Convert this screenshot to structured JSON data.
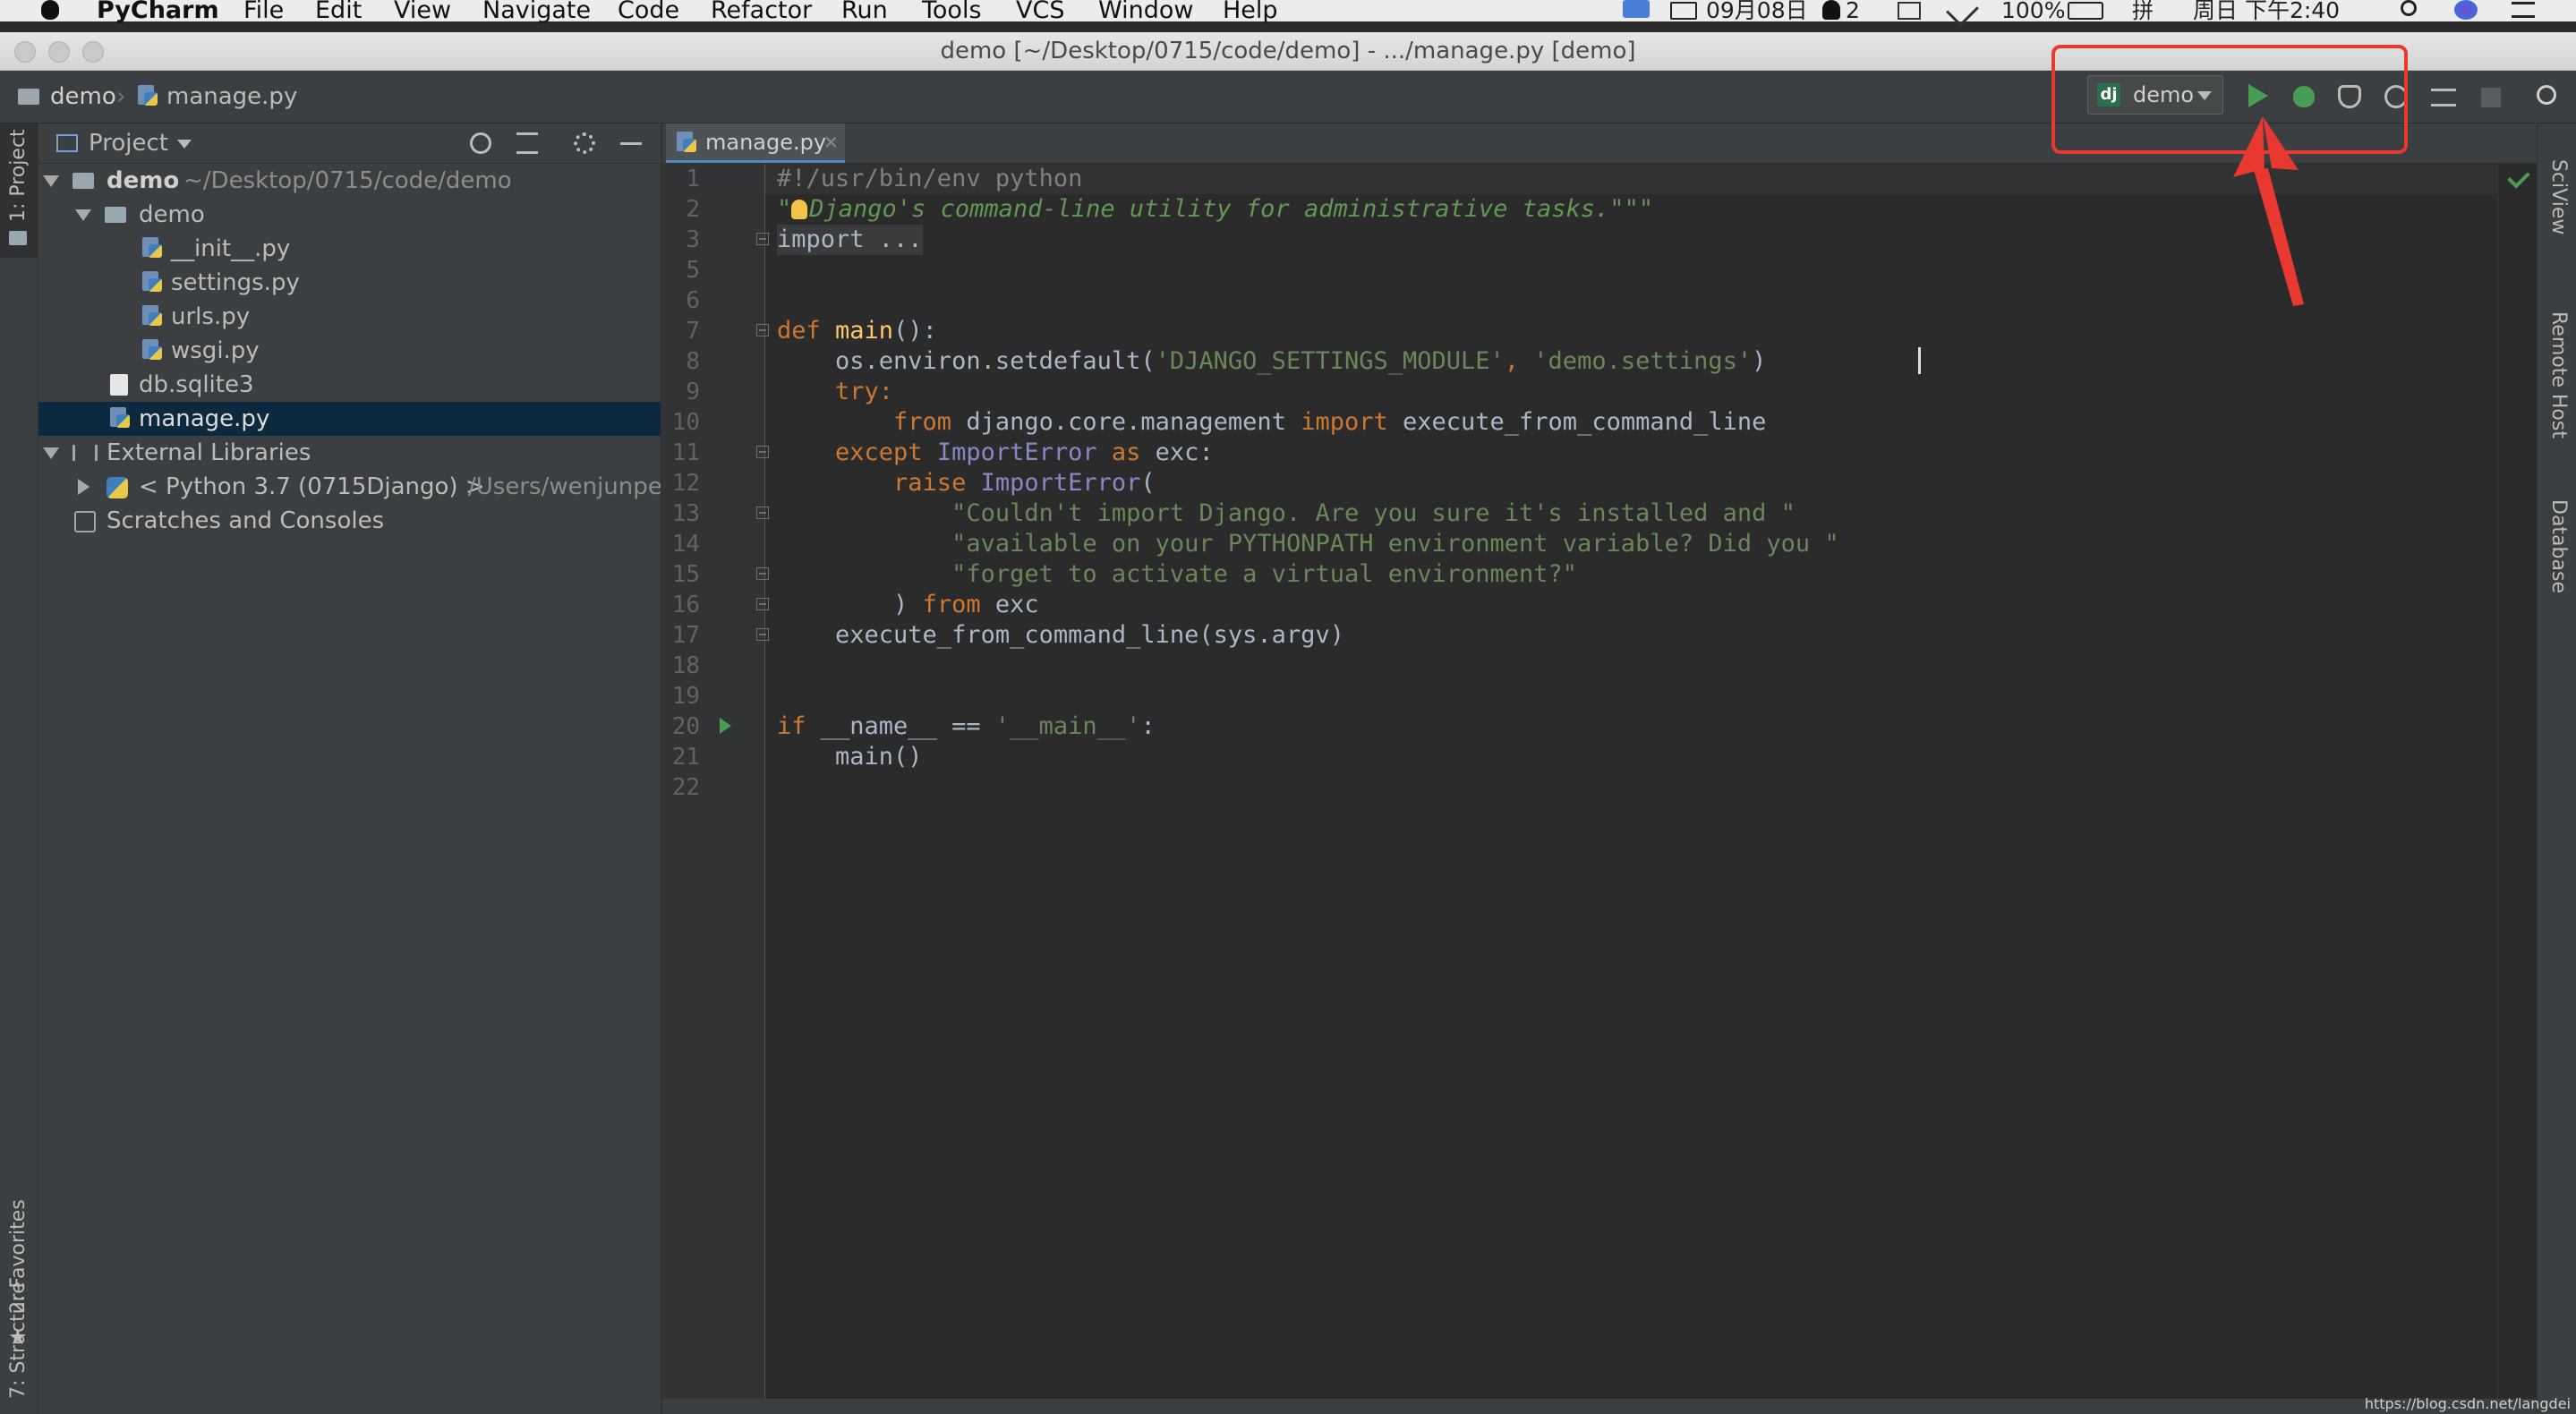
{
  "menubar": {
    "app": "PyCharm",
    "items": [
      "File",
      "Edit",
      "View",
      "Navigate",
      "Code",
      "Refactor",
      "Run",
      "Tools",
      "VCS",
      "Window",
      "Help"
    ],
    "status": {
      "date": "09月08日",
      "count": "2",
      "battery": "100%",
      "input_method": "拼",
      "clock": "周日 下午2:40"
    }
  },
  "window": {
    "title": "demo [~/Desktop/0715/code/demo] - .../manage.py [demo]"
  },
  "navbar": {
    "project": "demo",
    "file": "manage.py"
  },
  "toolbar": {
    "run_config": "demo",
    "dj_badge": "dj"
  },
  "left_tools": {
    "project": "1: Project",
    "favorites": "2: Favorites",
    "structure": "7: Structure"
  },
  "right_tools": {
    "sciview": "SciView",
    "remote_host": "Remote Host",
    "database": "Database"
  },
  "project_panel": {
    "title": "Project",
    "tree": {
      "root_name": "demo",
      "root_path": "~/Desktop/0715/code/demo",
      "pkg": "demo",
      "files": [
        "__init__.py",
        "settings.py",
        "urls.py",
        "wsgi.py"
      ],
      "db": "db.sqlite3",
      "manage": "manage.py",
      "ext_libs": "External Libraries",
      "python": "< Python 3.7 (0715Django) >",
      "python_path": "/Users/wenjunpen",
      "scratches": "Scratches and Consoles"
    }
  },
  "editor": {
    "tab": "manage.py",
    "lines": {
      "l1": "#!/usr/bin/env python",
      "l2_q": "\"",
      "l2": "Django's command-line utility for administrative tasks.\"\"\"",
      "l3": "import ...",
      "l7_def": "def ",
      "l7_fn": "main",
      "l7_rest": "():",
      "l8_a": "    os.environ.setdefault(",
      "l8_s1": "'DJANGO_SETTINGS_MODULE'",
      "l8_c": ", ",
      "l8_s2": "'demo.settings'",
      "l8_e": ")",
      "l9": "    try:",
      "l10_from": "        from ",
      "l10_mod": "django.core.management ",
      "l10_import": "import ",
      "l10_name": "execute_from_command_line",
      "l11_except": "    except ",
      "l11_err": "ImportError ",
      "l11_as": "as ",
      "l11_exc": "exc:",
      "l12_raise": "        raise ",
      "l12_err": "ImportError",
      "l12_p": "(",
      "l13": "            \"Couldn't import Django. Are you sure it's installed and \"",
      "l14": "            \"available on your PYTHONPATH environment variable? Did you \"",
      "l15": "            \"forget to activate a virtual environment?\"",
      "l16_a": "        ) ",
      "l16_from": "from ",
      "l16_exc": "exc",
      "l17": "    execute_from_command_line(sys.argv)",
      "l20_if": "if ",
      "l20_name": "__name__ ",
      "l20_eq": "== ",
      "l20_str": "'__main__'",
      "l20_c": ":",
      "l21": "    main()"
    }
  },
  "watermark": "https://blog.csdn.net/langdei",
  "colors": {
    "highlight": "#e8382f",
    "run_green": "#499c54",
    "editor_bg": "#2b2b2b",
    "panel_bg": "#3c3f41"
  }
}
